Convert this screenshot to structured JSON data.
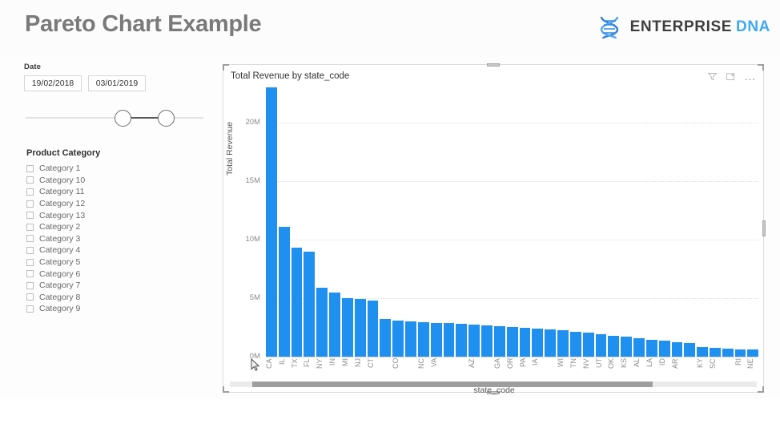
{
  "header": {
    "title": "Pareto Chart Example",
    "logo": {
      "icon": "dna-helix-icon",
      "primary": "ENTERPRISE",
      "secondary": "DNA",
      "primary_color": "#3d3d3d",
      "secondary_color": "#3fa9f5"
    }
  },
  "date_slicer": {
    "label": "Date",
    "start_value": "19/02/2018",
    "end_value": "03/01/2019"
  },
  "category_slicer": {
    "title": "Product Category",
    "items": [
      {
        "label": "Category 1",
        "checked": false
      },
      {
        "label": "Category 10",
        "checked": false
      },
      {
        "label": "Category 11",
        "checked": false
      },
      {
        "label": "Category 12",
        "checked": false
      },
      {
        "label": "Category 13",
        "checked": false
      },
      {
        "label": "Category 2",
        "checked": false
      },
      {
        "label": "Category 3",
        "checked": false
      },
      {
        "label": "Category 4",
        "checked": false
      },
      {
        "label": "Category 5",
        "checked": false
      },
      {
        "label": "Category 6",
        "checked": false
      },
      {
        "label": "Category 7",
        "checked": false
      },
      {
        "label": "Category 8",
        "checked": false
      },
      {
        "label": "Category 9",
        "checked": false
      }
    ]
  },
  "chart_visual": {
    "title": "Total Revenue by state_code",
    "icons": [
      {
        "name": "filter-icon"
      },
      {
        "name": "focus-mode-icon"
      },
      {
        "name": "more-options-icon",
        "glyph": "…"
      }
    ]
  },
  "chart_data": {
    "type": "bar",
    "title": "Total Revenue by state_code",
    "xlabel": "state_code",
    "ylabel": "Total Revenue",
    "ylim": [
      0,
      23000000
    ],
    "ytick_labels": [
      "0M",
      "5M",
      "10M",
      "15M",
      "20M"
    ],
    "ytick_values": [
      0,
      5000000,
      10000000,
      15000000,
      20000000
    ],
    "grid": true,
    "legend": "none",
    "bar_color": "#1f8ff0",
    "categories": [
      "CA",
      "IL",
      "TX",
      "FL",
      "NY",
      "IN",
      "MI",
      "NJ",
      "CT",
      "",
      "CO",
      "",
      "NC",
      "VA",
      "",
      "",
      "AZ",
      "",
      "GA",
      "OR",
      "PA",
      "IA",
      "",
      "WI",
      "TN",
      "NV",
      "UT",
      "OK",
      "KS",
      "AL",
      "LA",
      "ID",
      "AR",
      "",
      "KY",
      "SC",
      "",
      "RI",
      "NE"
    ],
    "values": [
      23000000,
      11100000,
      9300000,
      9000000,
      5900000,
      5500000,
      5000000,
      4900000,
      4800000,
      3200000,
      3100000,
      3000000,
      2950000,
      2900000,
      2850000,
      2800000,
      2750000,
      2700000,
      2600000,
      2500000,
      2450000,
      2400000,
      2300000,
      2250000,
      2150000,
      2050000,
      1900000,
      1800000,
      1700000,
      1550000,
      1450000,
      1350000,
      1250000,
      1150000,
      800000,
      750000,
      700000,
      650000,
      600000
    ]
  },
  "scrollbar": {
    "name": "horizontal-scrollbar"
  }
}
